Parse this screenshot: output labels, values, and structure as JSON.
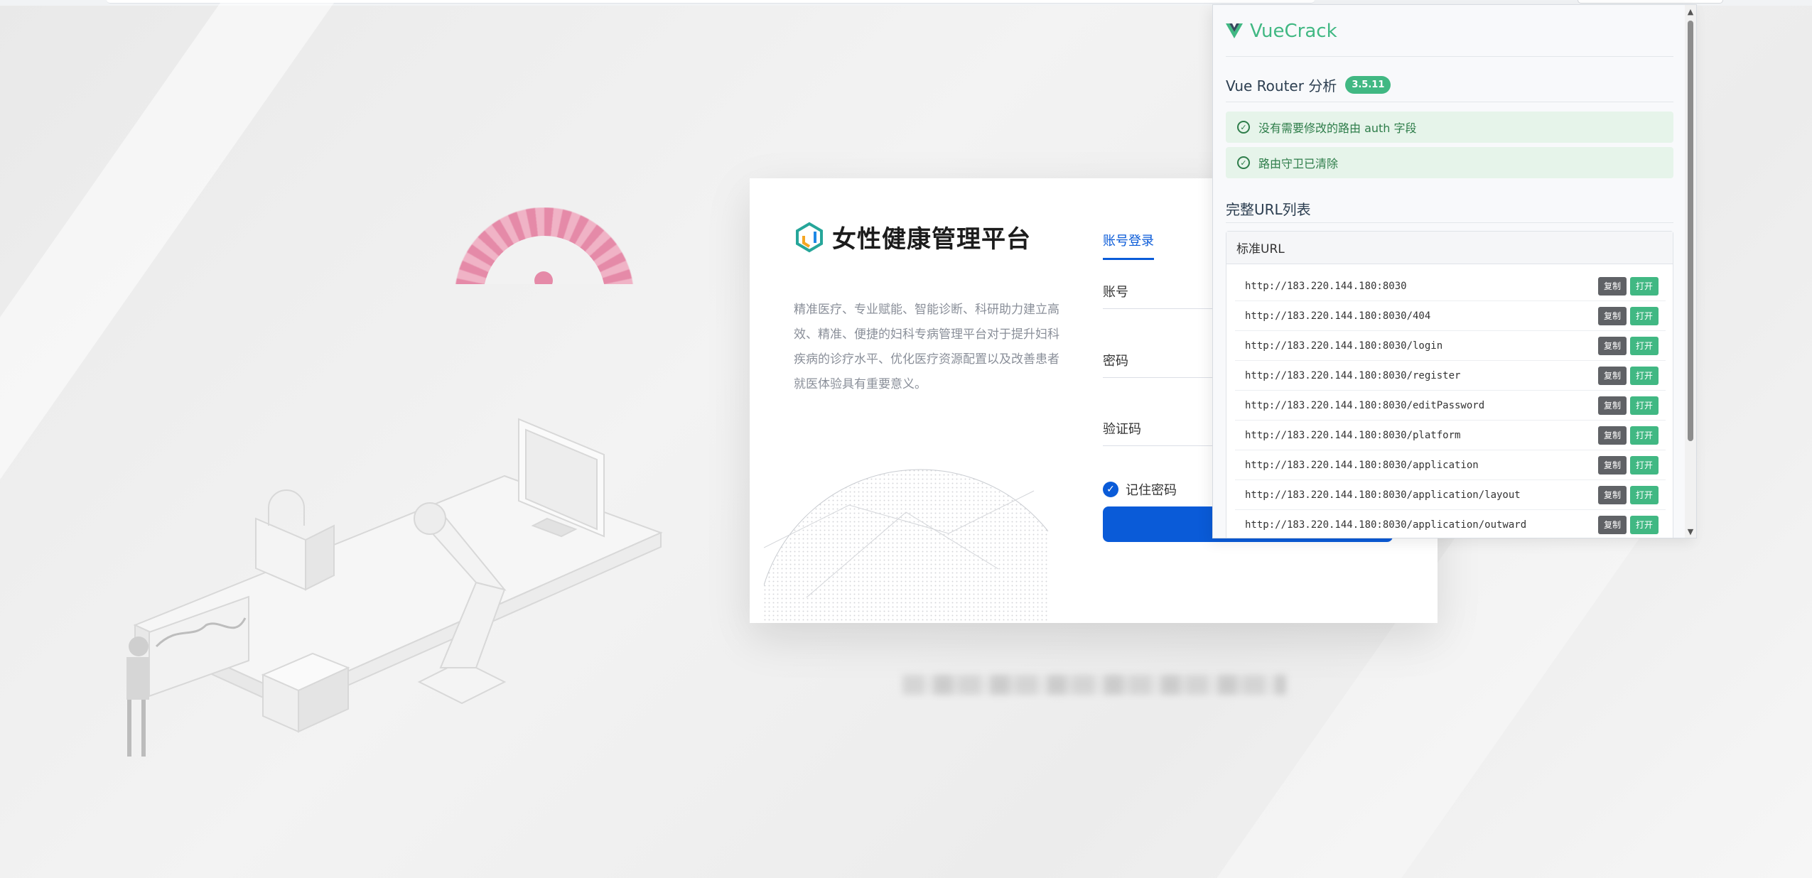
{
  "login": {
    "app_title": "女性健康管理平台",
    "description": "精准医疗、专业赋能、智能诊断、科研助力建立高效、精准、便捷的妇科专病管理平台对于提升妇科疾病的诊疗水平、优化医疗资源配置以及改善患者就医体验具有重要意义。",
    "tab_account_login": "账号登录",
    "account_label": "账号",
    "password_label": "密码",
    "captcha_label": "验证码",
    "remember_label": "记住密码",
    "remember_checked": true
  },
  "panel": {
    "brand": "VueCrack",
    "router_title": "Vue Router 分析",
    "version": "3.5.11",
    "alerts": [
      "没有需要修改的路由 auth 字段",
      "路由守卫已清除"
    ],
    "url_list_title": "完整URL列表",
    "standard_url_header": "标准URL",
    "copy_label": "复制",
    "open_label": "打开",
    "urls": [
      "http://183.220.144.180:8030",
      "http://183.220.144.180:8030/404",
      "http://183.220.144.180:8030/login",
      "http://183.220.144.180:8030/register",
      "http://183.220.144.180:8030/editPassword",
      "http://183.220.144.180:8030/platform",
      "http://183.220.144.180:8030/application",
      "http://183.220.144.180:8030/application/layout",
      "http://183.220.144.180:8030/application/outward"
    ]
  },
  "colors": {
    "vue_green": "#41b883",
    "primary_blue": "#0a5bd8",
    "alert_bg": "#e6f4ea"
  }
}
